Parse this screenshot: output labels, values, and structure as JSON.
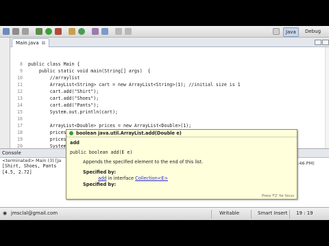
{
  "toolbar": {
    "java_label": "Java",
    "debug_label": "Debug"
  },
  "editor": {
    "tab_label": "Main.java",
    "tab_close": "⊠",
    "lines": [
      {
        "num": "",
        "text": ""
      },
      {
        "num": "",
        "text": ""
      },
      {
        "num": "8",
        "text": "public class Main {"
      },
      {
        "num": "9",
        "text": "    public static void main(String[] args)  {"
      },
      {
        "num": "10",
        "text": "        //arraylist"
      },
      {
        "num": "11",
        "text": "        ArrayList<String> cart = new ArrayList<String>(1); //initial size is 1"
      },
      {
        "num": "12",
        "text": "        cart.add(\"Shirt\");"
      },
      {
        "num": "13",
        "text": "        cart.add(\"Shoes\");"
      },
      {
        "num": "14",
        "text": "        cart.add(\"Pants\");"
      },
      {
        "num": "15",
        "text": "        System.out.println(cart);"
      },
      {
        "num": "16",
        "text": ""
      },
      {
        "num": "17",
        "text": "        ArrayList<Double> prices = new ArrayList<Double>(1);"
      },
      {
        "num": "18",
        "text": "        prices.add(4.5);"
      },
      {
        "num": "19",
        "text": "        prices.add(2.72);"
      },
      {
        "num": "20",
        "text": "        System."
      },
      {
        "num": "",
        "text": ""
      },
      {
        "num": "22",
        "text": "    }"
      }
    ]
  },
  "console": {
    "tab_label": "Console",
    "status": "<terminated> Main (3) [Ja",
    "output": [
      "[Shirt, Shoes, Pants",
      "[4.5, 2.72]"
    ],
    "time": "8:46 PM)"
  },
  "tooltip": {
    "signature": "boolean java.util.ArrayList.add(Double e)",
    "method_name": "add",
    "declaration": "public boolean add(E e)",
    "description": "Appends the specified element to the end of this list.",
    "specified_by_label": "Specified by:",
    "specified_by_method": "add",
    "specified_by_mid": " in interface ",
    "specified_by_interface": "Collection<E>",
    "specified_by_label2": "Specified by:",
    "footer": "Press 'F2' for focus"
  },
  "statusbar": {
    "user": "jmsclal@gmail.com",
    "writable": "Writable",
    "insert_mode": "Smart Insert",
    "position": "19 : 19"
  }
}
